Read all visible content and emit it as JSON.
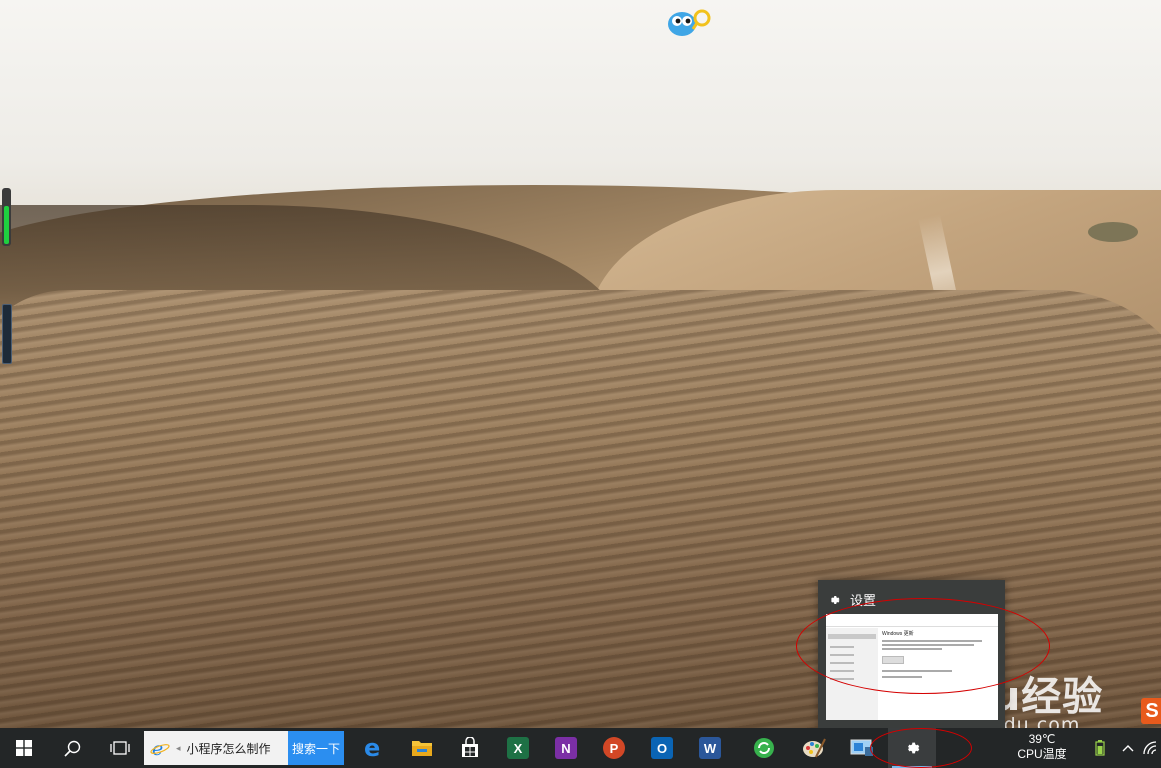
{
  "desktop": {
    "wallpaper": "desert-dunes",
    "mascot_icon": "owl-mascot-icon",
    "side_gauge_level": 0.7,
    "watermark": {
      "brand": "Baidu经验",
      "url": "jingyan.baidu.com"
    },
    "sogou_badge": "S"
  },
  "taskbar_preview": {
    "title": "设置",
    "icon": "gear-icon",
    "window_heading": "Windows 更新"
  },
  "taskbar": {
    "background": "#232627",
    "accent": "#76b9ed",
    "start_icon": "windows-logo-icon",
    "search_icon": "magnifier-icon",
    "task_view_icon": "task-view-icon",
    "search_box": {
      "icon": "ie-icon",
      "query": "小程序怎么制作",
      "button": "搜索一下"
    },
    "apps": [
      {
        "name": "edge",
        "icon": "edge-icon"
      },
      {
        "name": "file-explorer",
        "icon": "folder-icon"
      },
      {
        "name": "store",
        "icon": "store-bag-icon"
      },
      {
        "name": "excel",
        "icon": "excel-icon",
        "letter": "X",
        "color": "#1e7145"
      },
      {
        "name": "onenote",
        "icon": "onenote-icon",
        "letter": "N",
        "color": "#7b2fa5"
      },
      {
        "name": "powerpoint",
        "icon": "powerpoint-icon",
        "letter": "P",
        "color": "#d24726"
      },
      {
        "name": "outlook",
        "icon": "outlook-icon",
        "letter": "O",
        "color": "#0a64b4"
      },
      {
        "name": "word",
        "icon": "word-icon",
        "letter": "W",
        "color": "#2b579a"
      },
      {
        "name": "browser-360",
        "icon": "refresh-globe-icon"
      },
      {
        "name": "paint",
        "icon": "palette-icon"
      },
      {
        "name": "remote-desktop",
        "icon": "monitor-icon"
      },
      {
        "name": "settings",
        "icon": "gear-icon"
      }
    ],
    "tray": {
      "cpu_temp": "39℃",
      "cpu_label": "CPU温度",
      "battery_icon": "battery-icon",
      "chevron_icon": "chevron-up-icon",
      "network_icon": "wifi-icon"
    }
  }
}
